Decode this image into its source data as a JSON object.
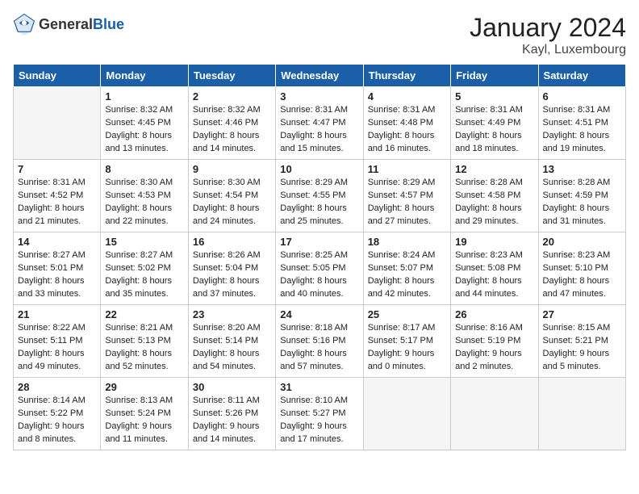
{
  "header": {
    "logo_general": "General",
    "logo_blue": "Blue",
    "month_title": "January 2024",
    "location": "Kayl, Luxembourg"
  },
  "weekdays": [
    "Sunday",
    "Monday",
    "Tuesday",
    "Wednesday",
    "Thursday",
    "Friday",
    "Saturday"
  ],
  "weeks": [
    [
      {
        "day": "",
        "sunrise": "",
        "sunset": "",
        "daylight": ""
      },
      {
        "day": "1",
        "sunrise": "Sunrise: 8:32 AM",
        "sunset": "Sunset: 4:45 PM",
        "daylight": "Daylight: 8 hours and 13 minutes."
      },
      {
        "day": "2",
        "sunrise": "Sunrise: 8:32 AM",
        "sunset": "Sunset: 4:46 PM",
        "daylight": "Daylight: 8 hours and 14 minutes."
      },
      {
        "day": "3",
        "sunrise": "Sunrise: 8:31 AM",
        "sunset": "Sunset: 4:47 PM",
        "daylight": "Daylight: 8 hours and 15 minutes."
      },
      {
        "day": "4",
        "sunrise": "Sunrise: 8:31 AM",
        "sunset": "Sunset: 4:48 PM",
        "daylight": "Daylight: 8 hours and 16 minutes."
      },
      {
        "day": "5",
        "sunrise": "Sunrise: 8:31 AM",
        "sunset": "Sunset: 4:49 PM",
        "daylight": "Daylight: 8 hours and 18 minutes."
      },
      {
        "day": "6",
        "sunrise": "Sunrise: 8:31 AM",
        "sunset": "Sunset: 4:51 PM",
        "daylight": "Daylight: 8 hours and 19 minutes."
      }
    ],
    [
      {
        "day": "7",
        "sunrise": "Sunrise: 8:31 AM",
        "sunset": "Sunset: 4:52 PM",
        "daylight": "Daylight: 8 hours and 21 minutes."
      },
      {
        "day": "8",
        "sunrise": "Sunrise: 8:30 AM",
        "sunset": "Sunset: 4:53 PM",
        "daylight": "Daylight: 8 hours and 22 minutes."
      },
      {
        "day": "9",
        "sunrise": "Sunrise: 8:30 AM",
        "sunset": "Sunset: 4:54 PM",
        "daylight": "Daylight: 8 hours and 24 minutes."
      },
      {
        "day": "10",
        "sunrise": "Sunrise: 8:29 AM",
        "sunset": "Sunset: 4:55 PM",
        "daylight": "Daylight: 8 hours and 25 minutes."
      },
      {
        "day": "11",
        "sunrise": "Sunrise: 8:29 AM",
        "sunset": "Sunset: 4:57 PM",
        "daylight": "Daylight: 8 hours and 27 minutes."
      },
      {
        "day": "12",
        "sunrise": "Sunrise: 8:28 AM",
        "sunset": "Sunset: 4:58 PM",
        "daylight": "Daylight: 8 hours and 29 minutes."
      },
      {
        "day": "13",
        "sunrise": "Sunrise: 8:28 AM",
        "sunset": "Sunset: 4:59 PM",
        "daylight": "Daylight: 8 hours and 31 minutes."
      }
    ],
    [
      {
        "day": "14",
        "sunrise": "Sunrise: 8:27 AM",
        "sunset": "Sunset: 5:01 PM",
        "daylight": "Daylight: 8 hours and 33 minutes."
      },
      {
        "day": "15",
        "sunrise": "Sunrise: 8:27 AM",
        "sunset": "Sunset: 5:02 PM",
        "daylight": "Daylight: 8 hours and 35 minutes."
      },
      {
        "day": "16",
        "sunrise": "Sunrise: 8:26 AM",
        "sunset": "Sunset: 5:04 PM",
        "daylight": "Daylight: 8 hours and 37 minutes."
      },
      {
        "day": "17",
        "sunrise": "Sunrise: 8:25 AM",
        "sunset": "Sunset: 5:05 PM",
        "daylight": "Daylight: 8 hours and 40 minutes."
      },
      {
        "day": "18",
        "sunrise": "Sunrise: 8:24 AM",
        "sunset": "Sunset: 5:07 PM",
        "daylight": "Daylight: 8 hours and 42 minutes."
      },
      {
        "day": "19",
        "sunrise": "Sunrise: 8:23 AM",
        "sunset": "Sunset: 5:08 PM",
        "daylight": "Daylight: 8 hours and 44 minutes."
      },
      {
        "day": "20",
        "sunrise": "Sunrise: 8:23 AM",
        "sunset": "Sunset: 5:10 PM",
        "daylight": "Daylight: 8 hours and 47 minutes."
      }
    ],
    [
      {
        "day": "21",
        "sunrise": "Sunrise: 8:22 AM",
        "sunset": "Sunset: 5:11 PM",
        "daylight": "Daylight: 8 hours and 49 minutes."
      },
      {
        "day": "22",
        "sunrise": "Sunrise: 8:21 AM",
        "sunset": "Sunset: 5:13 PM",
        "daylight": "Daylight: 8 hours and 52 minutes."
      },
      {
        "day": "23",
        "sunrise": "Sunrise: 8:20 AM",
        "sunset": "Sunset: 5:14 PM",
        "daylight": "Daylight: 8 hours and 54 minutes."
      },
      {
        "day": "24",
        "sunrise": "Sunrise: 8:18 AM",
        "sunset": "Sunset: 5:16 PM",
        "daylight": "Daylight: 8 hours and 57 minutes."
      },
      {
        "day": "25",
        "sunrise": "Sunrise: 8:17 AM",
        "sunset": "Sunset: 5:17 PM",
        "daylight": "Daylight: 9 hours and 0 minutes."
      },
      {
        "day": "26",
        "sunrise": "Sunrise: 8:16 AM",
        "sunset": "Sunset: 5:19 PM",
        "daylight": "Daylight: 9 hours and 2 minutes."
      },
      {
        "day": "27",
        "sunrise": "Sunrise: 8:15 AM",
        "sunset": "Sunset: 5:21 PM",
        "daylight": "Daylight: 9 hours and 5 minutes."
      }
    ],
    [
      {
        "day": "28",
        "sunrise": "Sunrise: 8:14 AM",
        "sunset": "Sunset: 5:22 PM",
        "daylight": "Daylight: 9 hours and 8 minutes."
      },
      {
        "day": "29",
        "sunrise": "Sunrise: 8:13 AM",
        "sunset": "Sunset: 5:24 PM",
        "daylight": "Daylight: 9 hours and 11 minutes."
      },
      {
        "day": "30",
        "sunrise": "Sunrise: 8:11 AM",
        "sunset": "Sunset: 5:26 PM",
        "daylight": "Daylight: 9 hours and 14 minutes."
      },
      {
        "day": "31",
        "sunrise": "Sunrise: 8:10 AM",
        "sunset": "Sunset: 5:27 PM",
        "daylight": "Daylight: 9 hours and 17 minutes."
      },
      {
        "day": "",
        "sunrise": "",
        "sunset": "",
        "daylight": ""
      },
      {
        "day": "",
        "sunrise": "",
        "sunset": "",
        "daylight": ""
      },
      {
        "day": "",
        "sunrise": "",
        "sunset": "",
        "daylight": ""
      }
    ]
  ]
}
